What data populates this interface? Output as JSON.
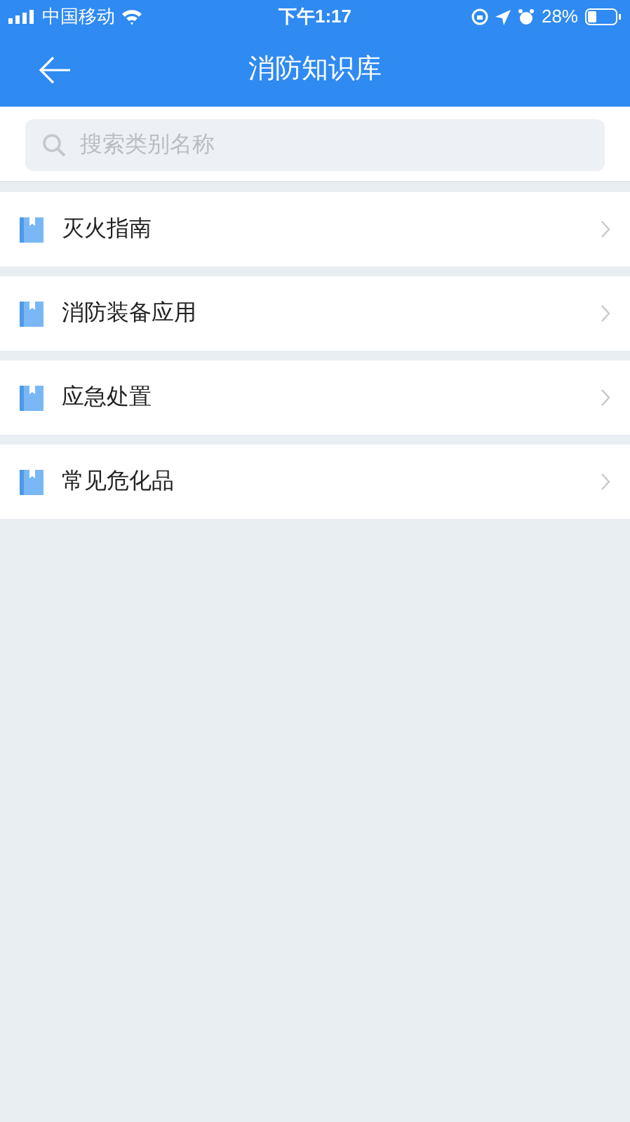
{
  "status_bar": {
    "carrier": "中国移动",
    "time": "下午1:17",
    "battery": "28%"
  },
  "nav": {
    "title": "消防知识库"
  },
  "search": {
    "placeholder": "搜索类别名称"
  },
  "categories": [
    {
      "label": "灭火指南"
    },
    {
      "label": "消防装备应用"
    },
    {
      "label": "应急处置"
    },
    {
      "label": "常见危化品"
    }
  ]
}
